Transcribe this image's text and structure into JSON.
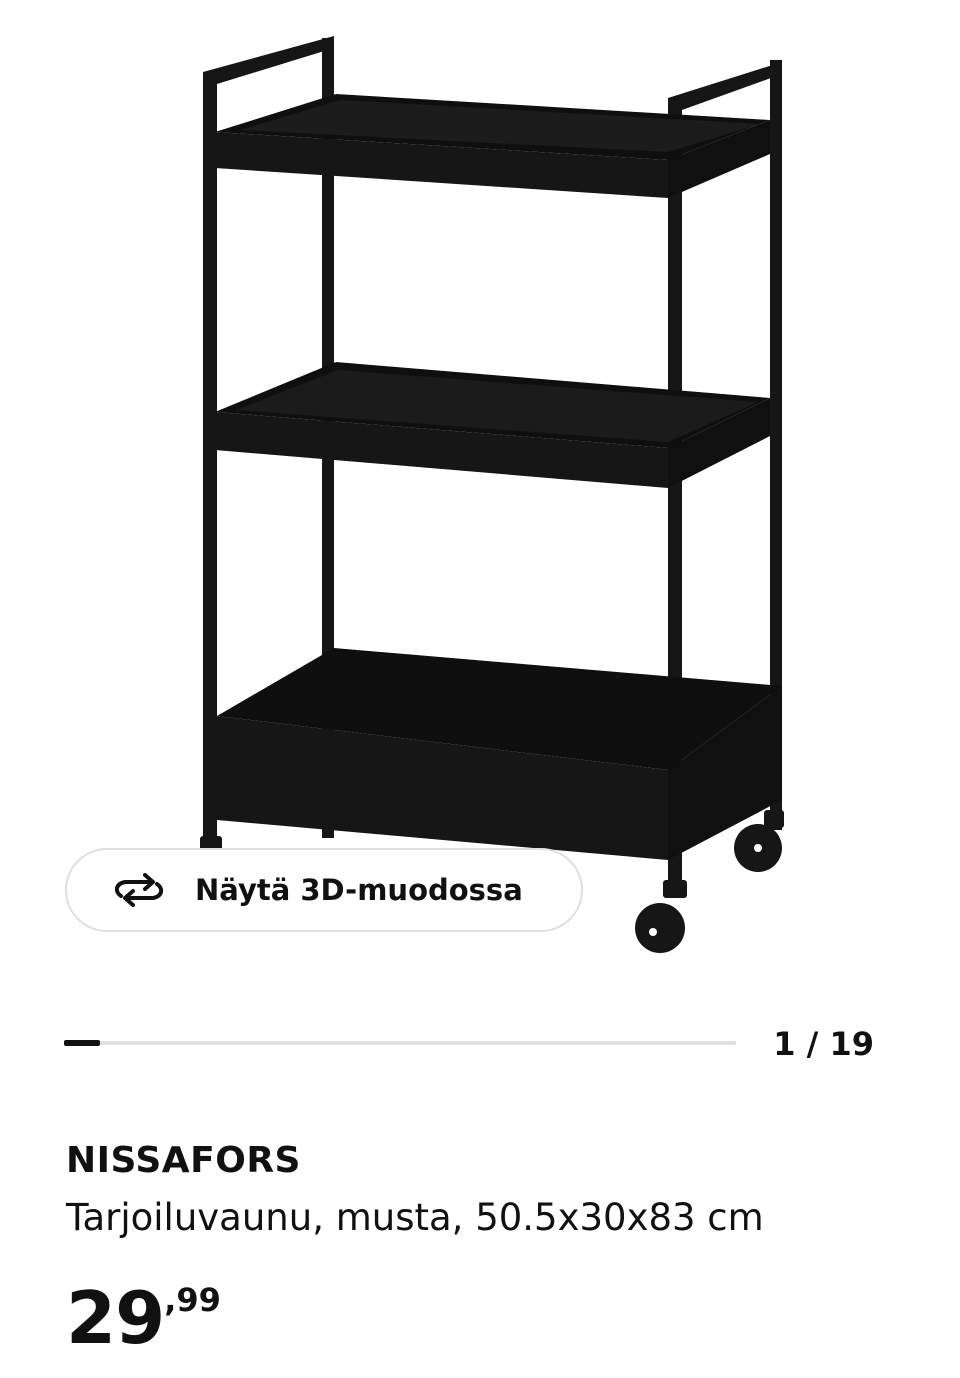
{
  "viewer": {
    "button_label": "Näytä 3D-muodossa",
    "button_icon": "rotate-3d-icon"
  },
  "carousel": {
    "counter": "1 / 19",
    "current": 1,
    "total": 19
  },
  "product": {
    "name": "NISSAFORS",
    "description": "Tarjoiluvaunu, musta, 50.5x30x83 cm",
    "price_whole": "29",
    "price_decimals": ",99"
  },
  "colors": {
    "text": "#111111",
    "border": "#dfdfdf",
    "product": "#161616"
  }
}
